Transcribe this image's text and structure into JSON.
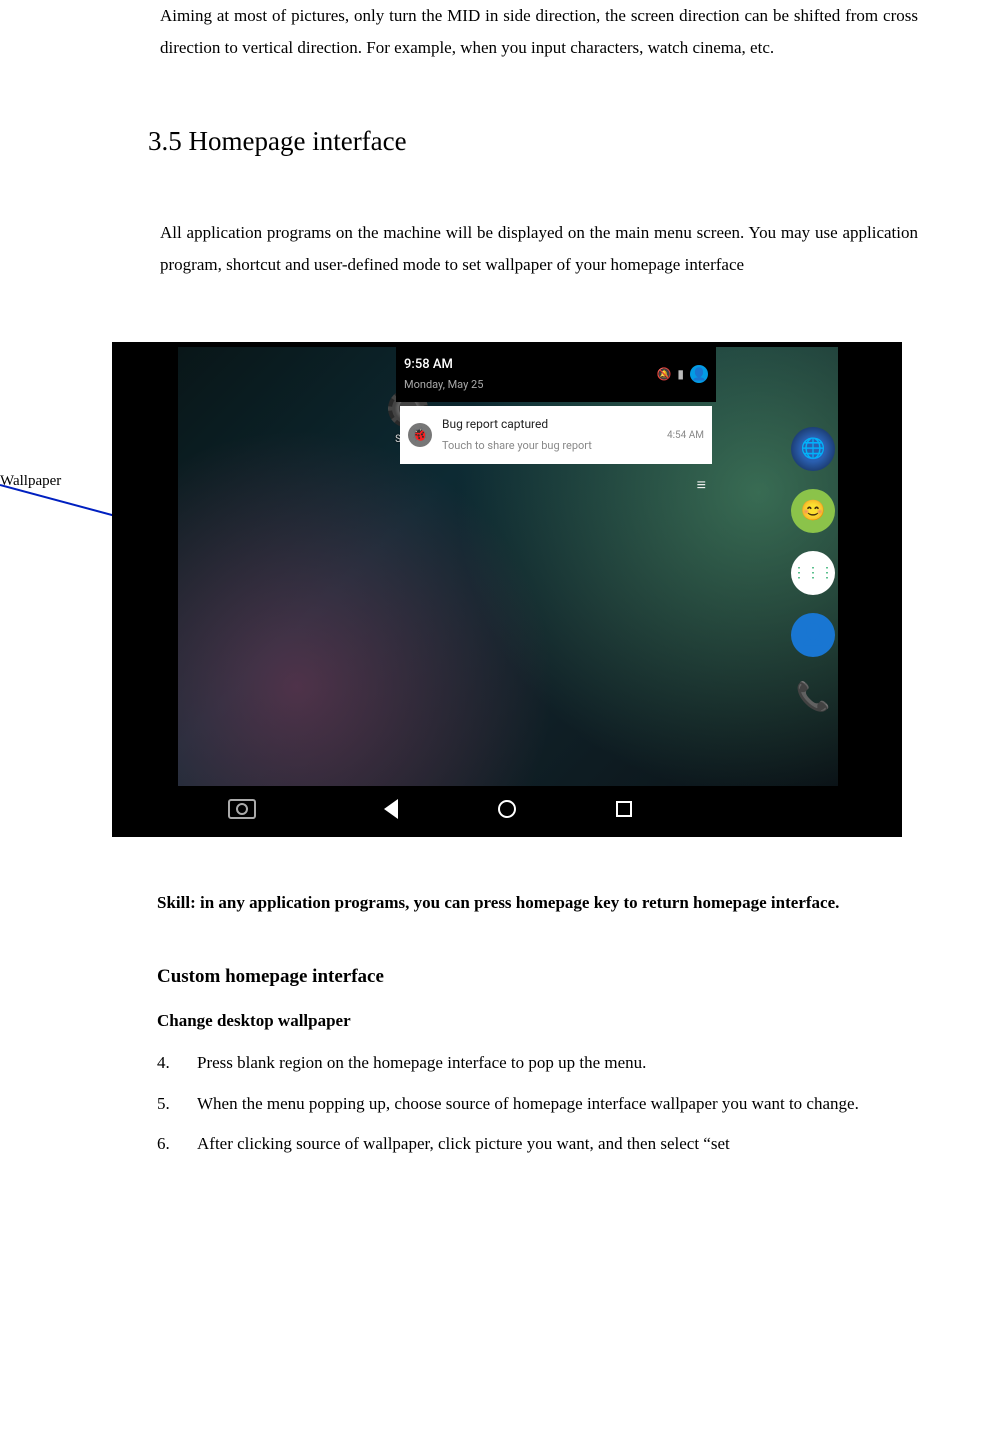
{
  "intro_paragraph": "Aiming at most of pictures, only turn the MID in side direction, the screen direction can be shifted from cross direction to vertical direction. For example, when you input characters, watch cinema, etc.",
  "section_heading": "3.5 Homepage interface",
  "section_body": "All application programs on the machine will be displayed on the main menu screen. You may use application program, shortcut and user-defined mode to set wallpaper of your homepage interface",
  "callout_label": "Wallpaper",
  "screenshot": {
    "time": "9:58 AM",
    "date": "Monday, May 25",
    "notification": {
      "title": "Bug report captured",
      "subtitle": "Touch to share your bug report",
      "time": "4:54 AM"
    },
    "settings_label": "Settin",
    "dock": {
      "browser": "browser-icon",
      "messaging": "messaging-icon",
      "apps": "all-apps-icon",
      "contacts": "contacts-icon",
      "phone": "phone-icon"
    },
    "nav": {
      "camera": "camera-icon",
      "back": "back-icon",
      "home": "home-icon",
      "recents": "recents-icon"
    },
    "status_icons": [
      "silent-icon",
      "battery-icon",
      "user-icon"
    ]
  },
  "skill_note": "Skill: in any application programs, you can press homepage key to return homepage interface.",
  "custom_heading": "Custom homepage interface",
  "wallpaper_heading": "Change desktop wallpaper",
  "steps": [
    {
      "num": "4.",
      "text": "Press blank region on the homepage interface to pop up the menu."
    },
    {
      "num": "5.",
      "text": "When the menu popping up, choose source of homepage interface wallpaper you want to change."
    },
    {
      "num": "6.",
      "text": "After clicking source of wallpaper, click picture you want, and then select “set"
    }
  ]
}
